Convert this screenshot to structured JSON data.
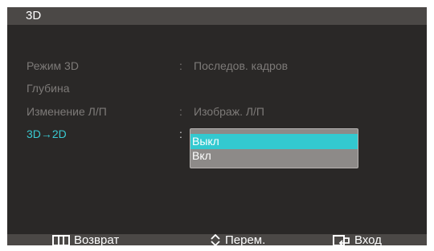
{
  "window": {
    "title": "3D"
  },
  "menu": {
    "items": [
      {
        "label": "Режим 3D",
        "value": "Последов. кадров"
      },
      {
        "label": "Глубина",
        "value": ""
      },
      {
        "label": "Изменение Л/П",
        "value": "Изображ. Л/П"
      },
      {
        "label": "3D→2D",
        "value": ""
      }
    ],
    "separator": ":"
  },
  "dropdown": {
    "options": [
      "Выкл",
      "Вкл"
    ],
    "selected": "Выкл"
  },
  "footer": {
    "back_label": "Возврат",
    "move_label": "Перем.",
    "enter_label": "Вход",
    "back_icon": "return-icon",
    "move_icon": "move-icon",
    "enter_icon": "enter-icon"
  },
  "colors": {
    "panel": "#2a2827",
    "bar": "#4b4846",
    "accent": "#39c9d1",
    "dropdown_bg": "#8d8a88"
  }
}
